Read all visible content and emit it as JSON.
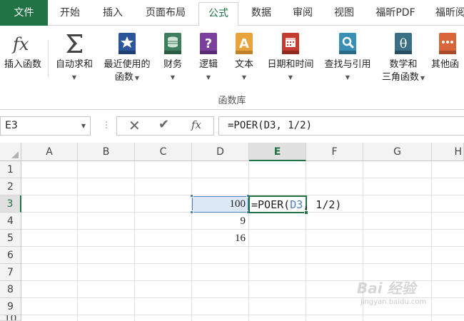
{
  "tabs": [
    {
      "label": "文件"
    },
    {
      "label": "开始"
    },
    {
      "label": "插入"
    },
    {
      "label": "页面布局"
    },
    {
      "label": "公式"
    },
    {
      "label": "数据"
    },
    {
      "label": "审阅"
    },
    {
      "label": "视图"
    },
    {
      "label": "福昕PDF"
    },
    {
      "label": "福昕阅"
    }
  ],
  "ribbon": {
    "insert_function": {
      "line1": "插入函数",
      "icon": "fx-icon"
    },
    "autosum": {
      "line1": "自动求和",
      "icon": "sigma-icon"
    },
    "recent": {
      "line1": "最近使用的",
      "line2": "函数",
      "icon": "star-book-icon"
    },
    "financial": {
      "line1": "财务",
      "icon": "coins-book-icon"
    },
    "logical": {
      "line1": "逻辑",
      "icon": "question-book-icon"
    },
    "text": {
      "line1": "文本",
      "icon": "letter-a-book-icon"
    },
    "datetime": {
      "line1": "日期和时间",
      "icon": "calendar-book-icon"
    },
    "lookup": {
      "line1": "查找与引用",
      "icon": "magnifier-book-icon"
    },
    "math": {
      "line1": "数学和",
      "line2": "三角函数",
      "icon": "theta-book-icon"
    },
    "other": {
      "line1": "其他函",
      "icon": "dots-book-icon"
    },
    "group_label": "函数库",
    "colors": {
      "green": "#217346",
      "blue": "#2b579a",
      "purple": "#7b3f9e",
      "orange": "#e8a33c",
      "red": "#c43b2f",
      "teal": "#3a8fb7",
      "slate": "#3a6f85",
      "deep_orange": "#d9653b"
    }
  },
  "formula_bar": {
    "name_box": "E3",
    "formula": "=POER(D3, 1/2)"
  },
  "grid": {
    "columns": [
      "A",
      "B",
      "C",
      "D",
      "E",
      "F",
      "G",
      "H"
    ],
    "rows": [
      "1",
      "2",
      "3",
      "4",
      "5",
      "6",
      "7",
      "8",
      "9",
      "10"
    ],
    "selected_column": "E",
    "selected_row": "3",
    "cells": {
      "D3": "100",
      "D4": "9",
      "D5": "16",
      "E3_prefix": "=POER(",
      "E3_ref": "D3",
      "E3_suffix": ", 1/2)"
    }
  },
  "watermark": {
    "main": "Bai 经验",
    "sub": "jingyan.baidu.com"
  }
}
